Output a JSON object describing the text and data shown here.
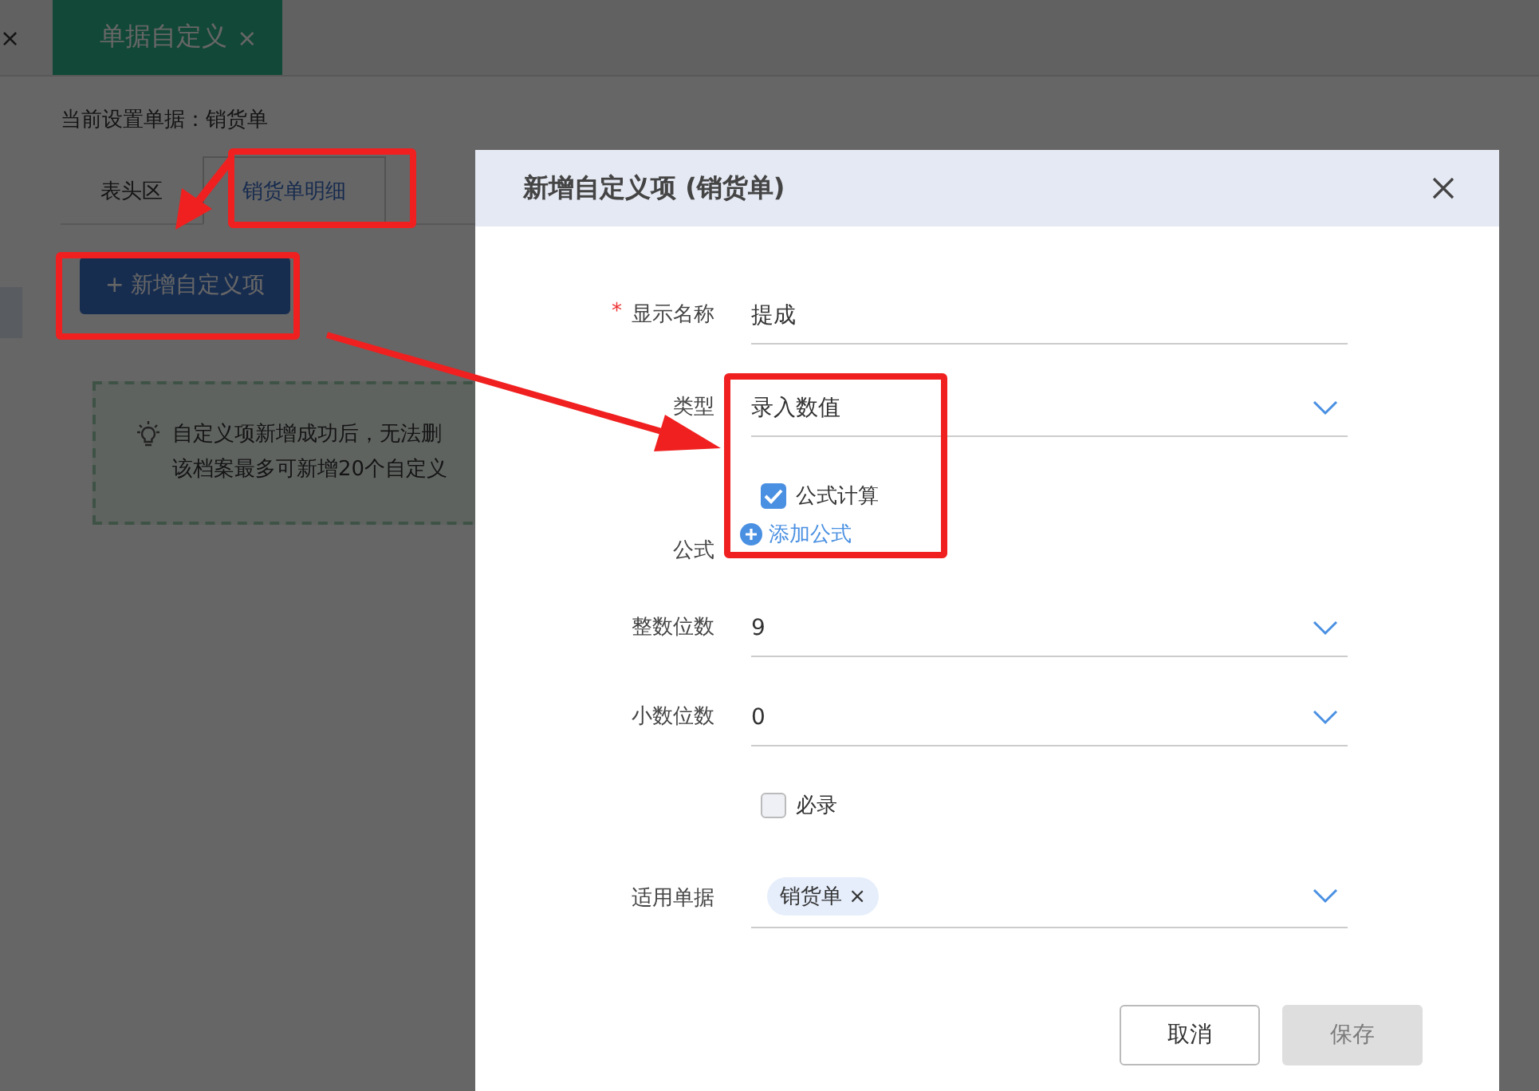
{
  "top_tabs": [
    {
      "close": "×",
      "selected": false
    },
    {
      "label": "单据自定义",
      "close": "×",
      "selected": true
    }
  ],
  "current_doc": "当前设置单据：销货单",
  "area_tabs": [
    {
      "label": "表头区",
      "selected": false
    },
    {
      "label": "销货单明细",
      "selected": true
    }
  ],
  "add_button": {
    "icon": "+",
    "label": "新增自定义项"
  },
  "tip": {
    "lines": [
      "自定义项新增成功后，无法删",
      "该档案最多可新增20个自定义"
    ]
  },
  "dialog": {
    "title": "新增自定义项 (销货单)",
    "rows": [
      {
        "kind": "input",
        "label": "显示名称",
        "required_mark": "*",
        "value": "提成"
      },
      {
        "kind": "select",
        "label": "类型",
        "value": "录入数值"
      },
      {
        "kind": "checkbox",
        "text": "公式计算",
        "checked": true
      },
      {
        "kind": "formula",
        "label": "公式",
        "link": "添加公式"
      },
      {
        "kind": "select",
        "label": "整数位数",
        "value": "9"
      },
      {
        "kind": "select",
        "label": "小数位数",
        "value": "0"
      },
      {
        "kind": "checkbox",
        "text": "必录",
        "checked": false
      },
      {
        "kind": "tags",
        "label": "适用单据",
        "tags": [
          {
            "label": "销货单",
            "remove": "×"
          }
        ]
      }
    ],
    "buttons": [
      {
        "label": "取消",
        "disabled": false
      },
      {
        "label": "保存",
        "disabled": true
      }
    ]
  }
}
